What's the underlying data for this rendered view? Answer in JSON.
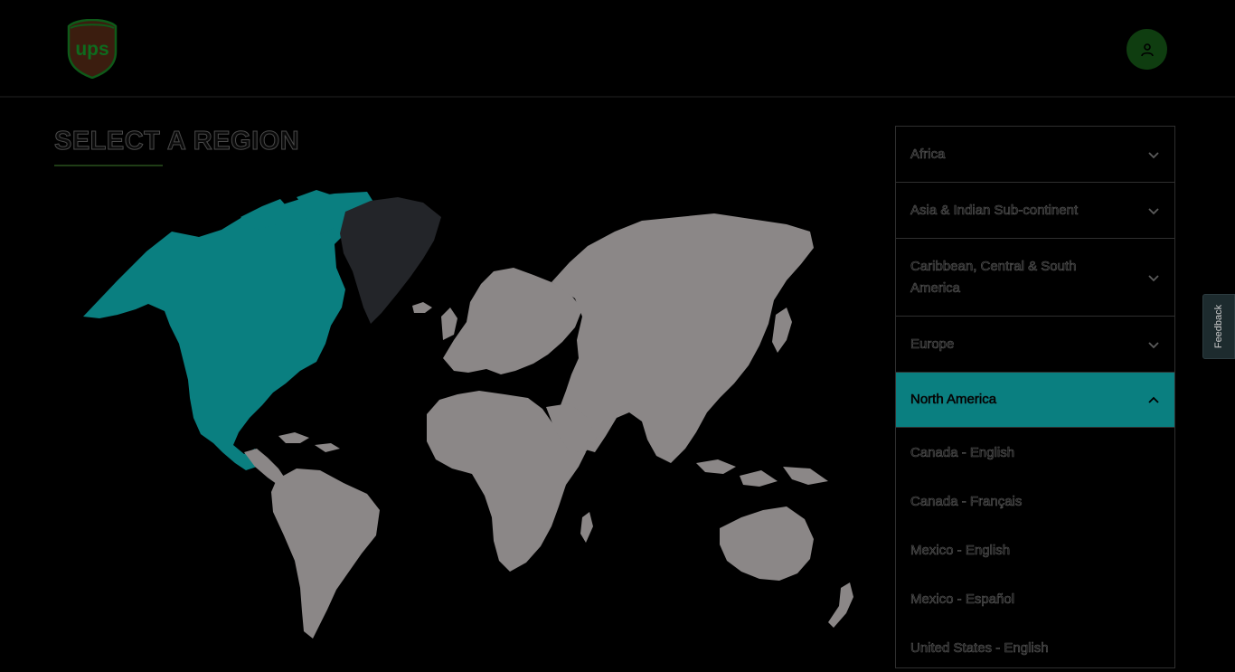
{
  "header": {
    "logo_text": "ups",
    "account_icon": "user-icon"
  },
  "page": {
    "title": "SELECT A REGION"
  },
  "regions": [
    {
      "label": "Africa",
      "expanded": false
    },
    {
      "label": "Asia & Indian Sub-continent",
      "expanded": false
    },
    {
      "label": "Caribbean, Central & South America",
      "expanded": false
    },
    {
      "label": "Europe",
      "expanded": false
    },
    {
      "label": "North America",
      "expanded": true
    }
  ],
  "north_america_countries": [
    "Canada - English",
    "Canada - Français",
    "Mexico - English",
    "Mexico - Español",
    "United States - English"
  ],
  "feedback": {
    "label": "Feedback"
  },
  "colors": {
    "accent": "#0a7f80",
    "brand_brown": "#351c15",
    "brand_gold": "#ffb500",
    "map_land": "#8b8787",
    "map_greenland": "#232529"
  }
}
